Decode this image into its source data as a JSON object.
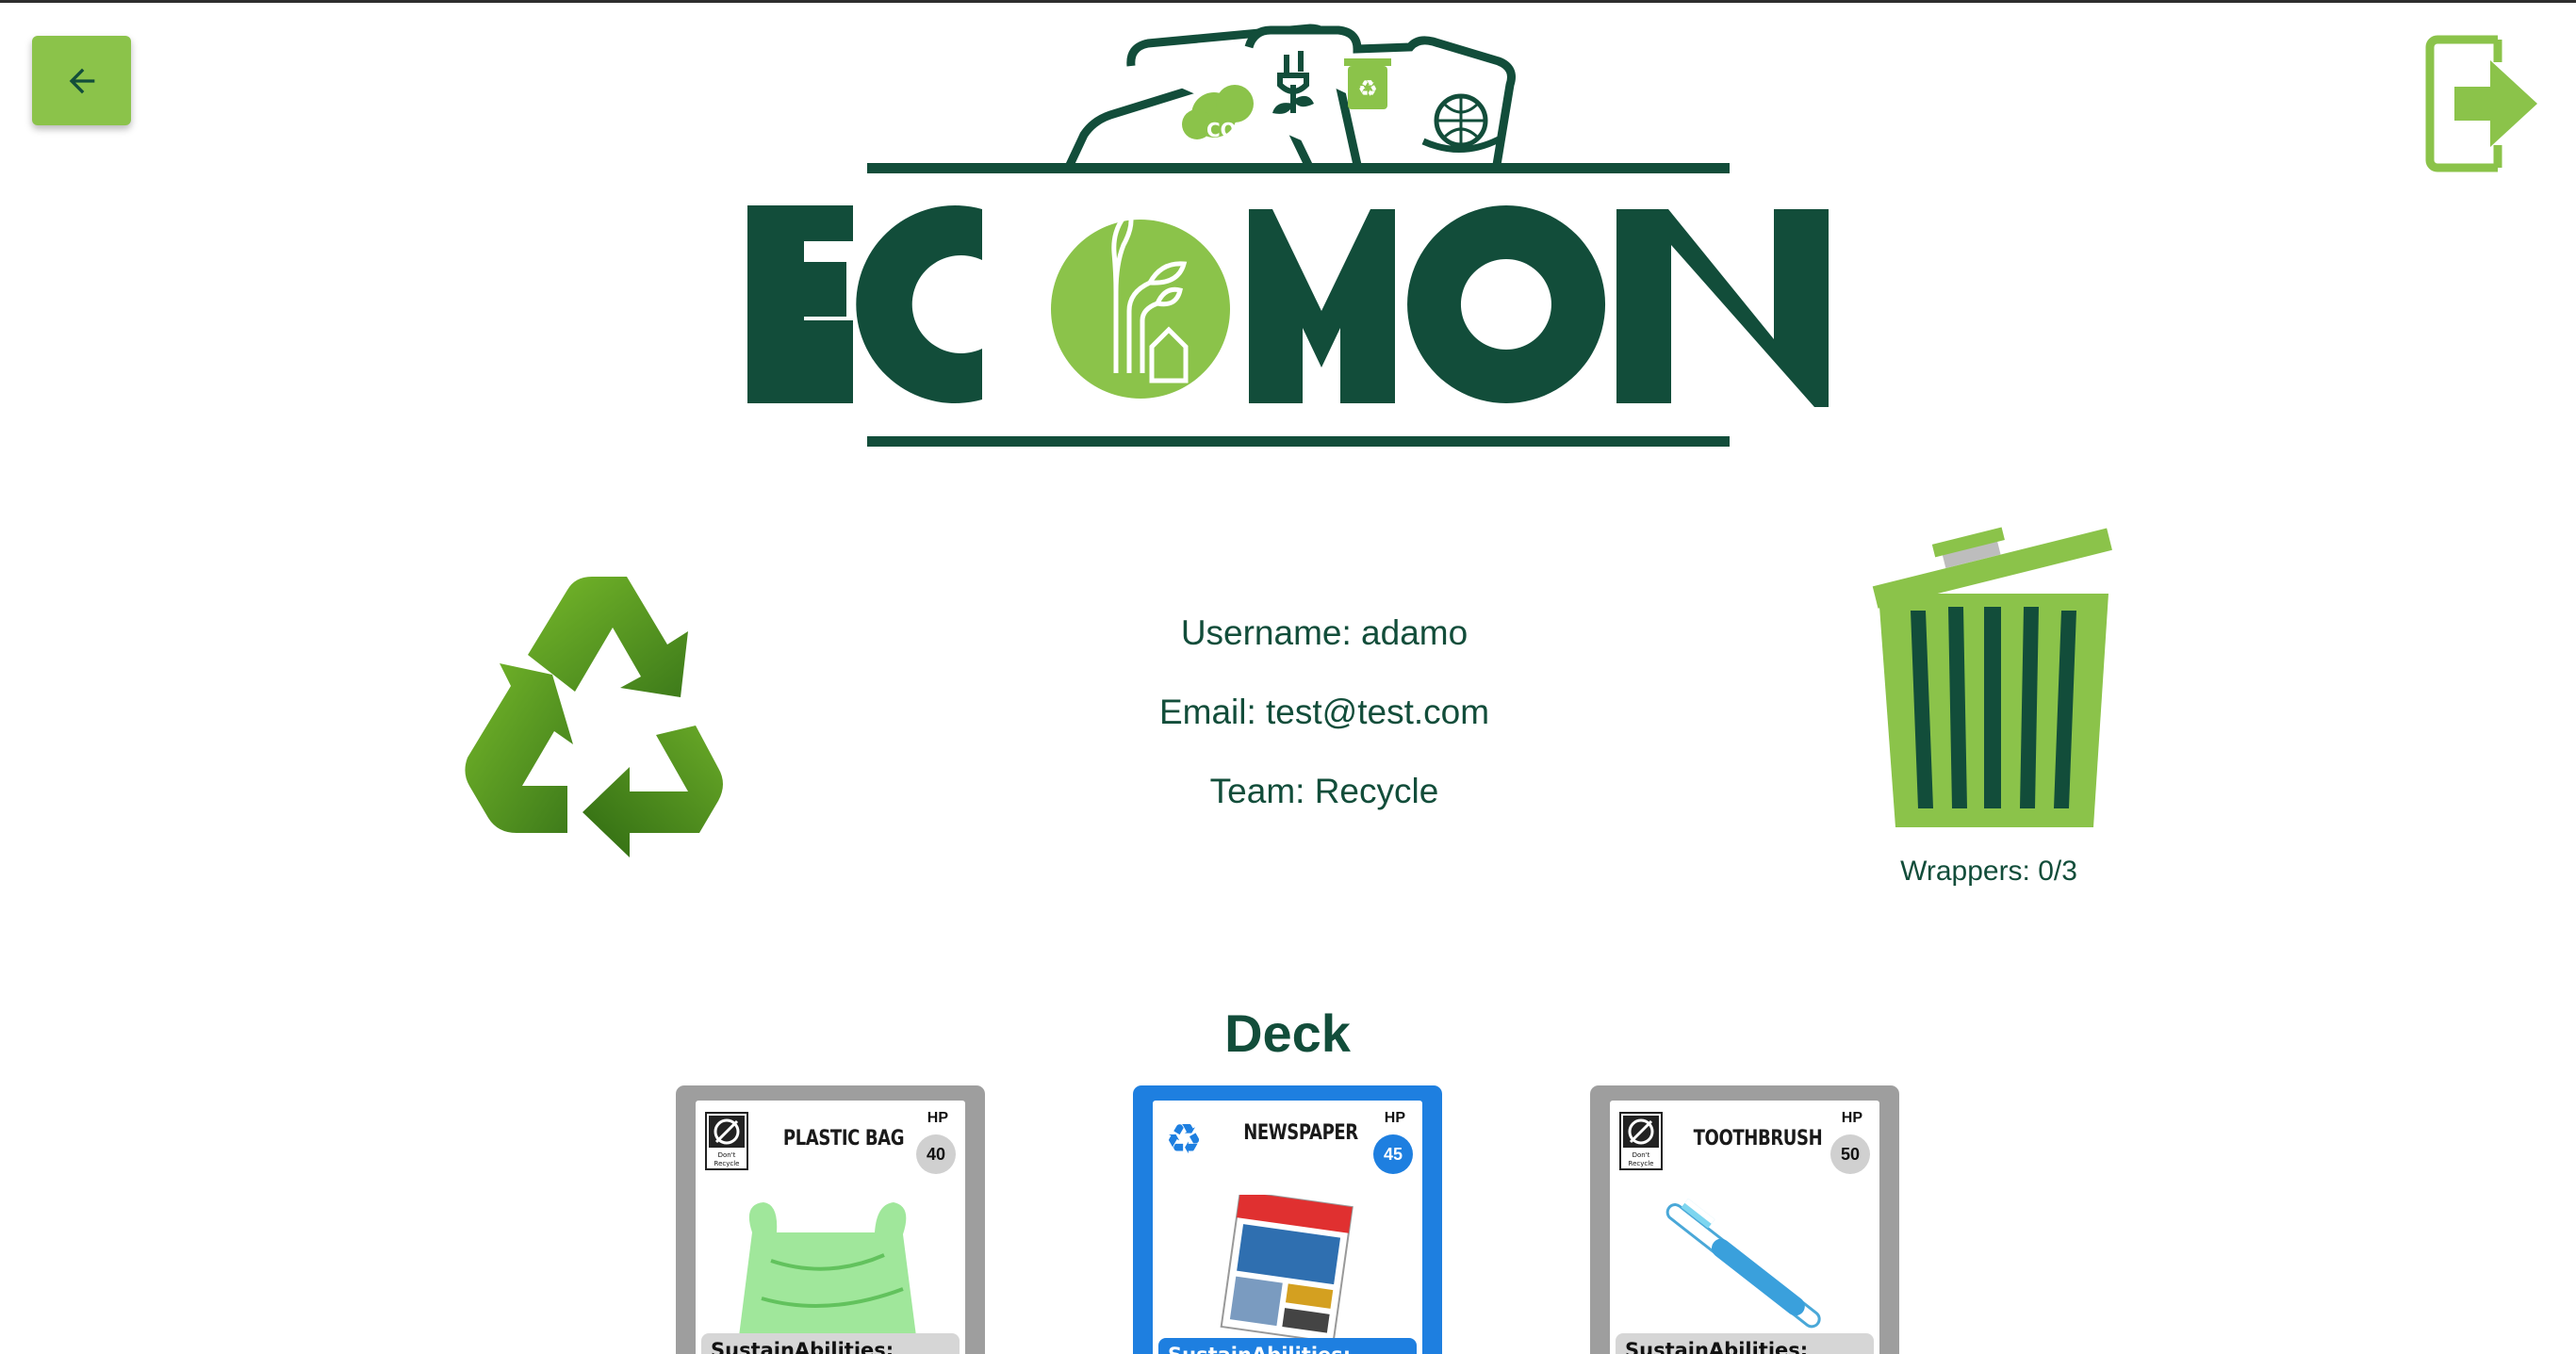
{
  "header": {
    "back_icon": "arrow-left-icon",
    "logout_icon": "logout-icon",
    "logo_text": "ECOMON"
  },
  "profile": {
    "username": "Username: adamo",
    "email": "Email: test@test.com",
    "team": "Team: Recycle"
  },
  "trash": {
    "icon": "trash-bin-icon",
    "wrappers": "Wrappers: 0/3"
  },
  "deck": {
    "title": "Deck",
    "cards": [
      {
        "name": "PLASTIC BAG",
        "hp_label": "HP",
        "hp": "40",
        "type": "Don't Recycle",
        "abilities": "SustainAbilities:",
        "theme": "gray"
      },
      {
        "name": "NEWSPAPER",
        "hp_label": "HP",
        "hp": "45",
        "type": "Recycle",
        "abilities": "SustainAbilities:",
        "theme": "blue"
      },
      {
        "name": "TOOTHBRUSH",
        "hp_label": "HP",
        "hp": "50",
        "type": "Don't Recycle",
        "abilities": "SustainAbilities:",
        "theme": "gray"
      }
    ]
  },
  "colors": {
    "brand_dark": "#124d3a",
    "brand_light": "#8bc34a",
    "card_gray": "#9e9e9e",
    "card_blue": "#1e7fe0"
  }
}
